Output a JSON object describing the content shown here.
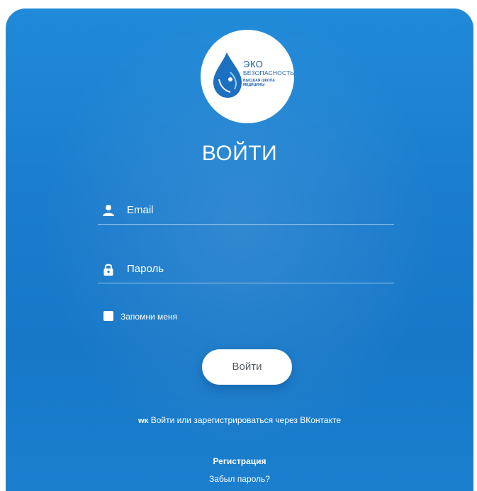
{
  "logo": {
    "line1": "ЭКО",
    "line2": "БЕЗОПАСНОСТЬ",
    "line3": "ВЫСШАЯ ШКОЛА",
    "line4": "МЕДИЦИНЫ"
  },
  "title": "ВОЙТИ",
  "form": {
    "email_placeholder": "Email",
    "password_placeholder": "Пароль",
    "remember_label": "Запомни меня",
    "submit_label": "Войти"
  },
  "links": {
    "vk_login": "Войти или зарегистрироваться через ВКонтакте",
    "register": "Регистрация",
    "forgot_password": "Забыл пароль?"
  },
  "icons": {
    "email": "user-icon",
    "password": "lock-icon",
    "vk": "vk-icon"
  },
  "colors": {
    "background": "#1b7ccd",
    "text": "#ffffff",
    "logo_text": "#1b5fa8"
  }
}
